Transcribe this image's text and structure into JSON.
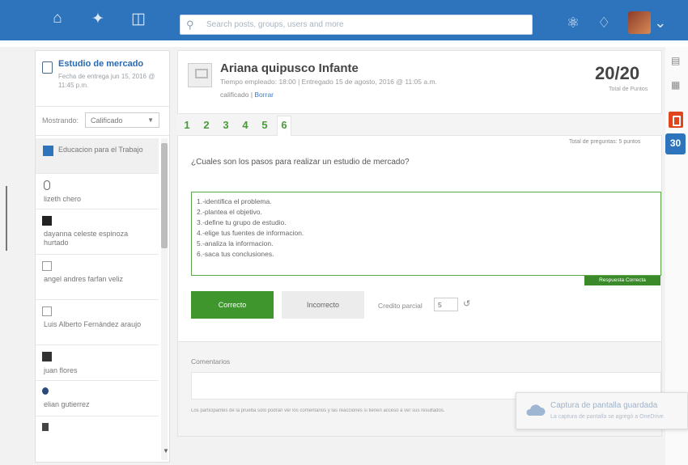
{
  "header": {
    "nav_icons": [
      "home-icon",
      "compass-icon",
      "book-icon"
    ],
    "search_placeholder": "Search posts, groups, users and more",
    "right_icons": [
      "assignments-icon",
      "bell-icon"
    ],
    "brand_color": "#2d74bd"
  },
  "assignment": {
    "title": "Estudio de mercado",
    "due": "Fecha de entrega jun 15, 2016 @ 11:45 p.m."
  },
  "filter": {
    "label": "Mostrando:",
    "value": "Calificado"
  },
  "students": [
    {
      "name": "Educacion para el Trabajo",
      "avatar": "group"
    },
    {
      "name": "lizeth chero",
      "avatar": "photo"
    },
    {
      "name": "dayanna celeste espinoza hurtado",
      "avatar": "photo"
    },
    {
      "name": "angel andres farfan veliz",
      "avatar": "default"
    },
    {
      "name": "Luis Alberto Fernández araujo",
      "avatar": "default"
    },
    {
      "name": "juan flores",
      "avatar": "photo"
    },
    {
      "name": "elian gutierrez",
      "avatar": "photo"
    },
    {
      "name": "",
      "avatar": "photo"
    }
  ],
  "submission": {
    "student_name": "Ariana quipusco Infante",
    "meta": "Tiempo empleado: 18:00  |  Entregado 15 de agosto, 2016 @ 11:05 a.m.",
    "status": "calificado",
    "delete_link": "Borrar",
    "score": "20/20",
    "score_label": "Total de Puntos"
  },
  "question_tabs": [
    "1",
    "2",
    "3",
    "4",
    "5",
    "6"
  ],
  "active_tab": "6",
  "total_questions": "Total de preguntas: 5 puntos",
  "question": "¿Cuales son los pasos para realizar un estudio de mercado?",
  "answer_lines": [
    "1.-identifica el problema.",
    "2.-plantea el objetivo.",
    "3.-define tu grupo de estudio.",
    "4.-elige tus fuentes de informacion.",
    "5.-analiza la informacion.",
    "6.-saca tus conclusiones."
  ],
  "correct_tag": "Respuesta Correcta",
  "buttons": {
    "correct": "Correcto",
    "incorrect": "Incorrecto",
    "partial_label": "Credito parcial",
    "partial_value": "5"
  },
  "comments": {
    "label": "Comentarios",
    "notice": "Los participantes de la prueba solo podrán ver los comentarios y las reacciones si tienen acceso a ver sus resultados."
  },
  "toast": {
    "title": "Captura de pantalla guardada",
    "subtitle": "La captura de pantalla se agregó a OneDrive."
  },
  "rail": {
    "calendar_day": "30"
  }
}
